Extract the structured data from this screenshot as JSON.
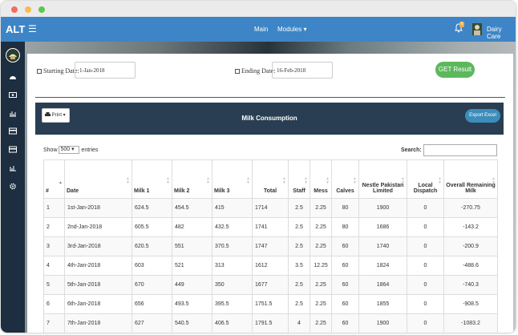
{
  "navbar": {
    "brand": "ALT",
    "menu_icon": "hamburger-icon",
    "main_label": "Main",
    "modules_label": "Modules ▾",
    "notification_count": "6",
    "user_name": "Dairy Care"
  },
  "colors": {
    "navbar": "#3d85c6",
    "sidebar": "#1c2e40",
    "panel_header": "#293e52",
    "get_button": "#5cb85c",
    "export_button": "#3c8dbc"
  },
  "sidebar": {
    "icons": [
      "dashboard-icon",
      "money-icon",
      "bar-chart-icon",
      "credit-card-icon",
      "credit-card-icon",
      "chart-icon",
      "settings-icon"
    ]
  },
  "filters": {
    "start_label": "Starting Date:",
    "start_value": "1-Jan-2018",
    "end_label": "Ending Date:",
    "end_value": "16-Feb-2018",
    "get_button": "GET Result"
  },
  "panel": {
    "print_label": "Print ▾",
    "title": "Milk Consumption",
    "export_label": "Export Excel"
  },
  "controls": {
    "show_label": "Show",
    "entries_value": "500",
    "entries_label": "entries",
    "search_label": "Search:"
  },
  "table": {
    "headers": [
      "#",
      "Date",
      "Milk 1",
      "Milk 2",
      "Milk 3",
      "Total",
      "Staff",
      "Mess",
      "Calves",
      "Nestle Pakistan Limited",
      "Local Dispatch",
      "Overall Remaining Milk"
    ],
    "rows": [
      [
        "1",
        "1st-Jan-2018",
        "624.5",
        "454.5",
        "415",
        "1714",
        "2.5",
        "2.25",
        "80",
        "1900",
        "0",
        "-270.75"
      ],
      [
        "2",
        "2nd-Jan-2018",
        "605.5",
        "482",
        "432.5",
        "1741",
        "2.5",
        "2.25",
        "80",
        "1686",
        "0",
        "-143.2"
      ],
      [
        "3",
        "3rd-Jan-2018",
        "620.5",
        "551",
        "370.5",
        "1747",
        "2.5",
        "2.25",
        "60",
        "1740",
        "0",
        "-200.9"
      ],
      [
        "4",
        "4th-Jan-2018",
        "603",
        "521",
        "313",
        "1612",
        "3.5",
        "12.25",
        "60",
        "1824",
        "0",
        "-488.6"
      ],
      [
        "5",
        "5th-Jan-2018",
        "670",
        "449",
        "350",
        "1677",
        "2.5",
        "2.25",
        "60",
        "1864",
        "0",
        "-740.3"
      ],
      [
        "6",
        "6th-Jan-2018",
        "656",
        "493.5",
        "395.5",
        "1751.5",
        "2.5",
        "2.25",
        "60",
        "1855",
        "0",
        "-908.5"
      ],
      [
        "7",
        "7th-Jan-2018",
        "627",
        "540.5",
        "406.5",
        "1791.5",
        "4",
        "2.25",
        "60",
        "1900",
        "0",
        "-1083.2"
      ]
    ]
  }
}
